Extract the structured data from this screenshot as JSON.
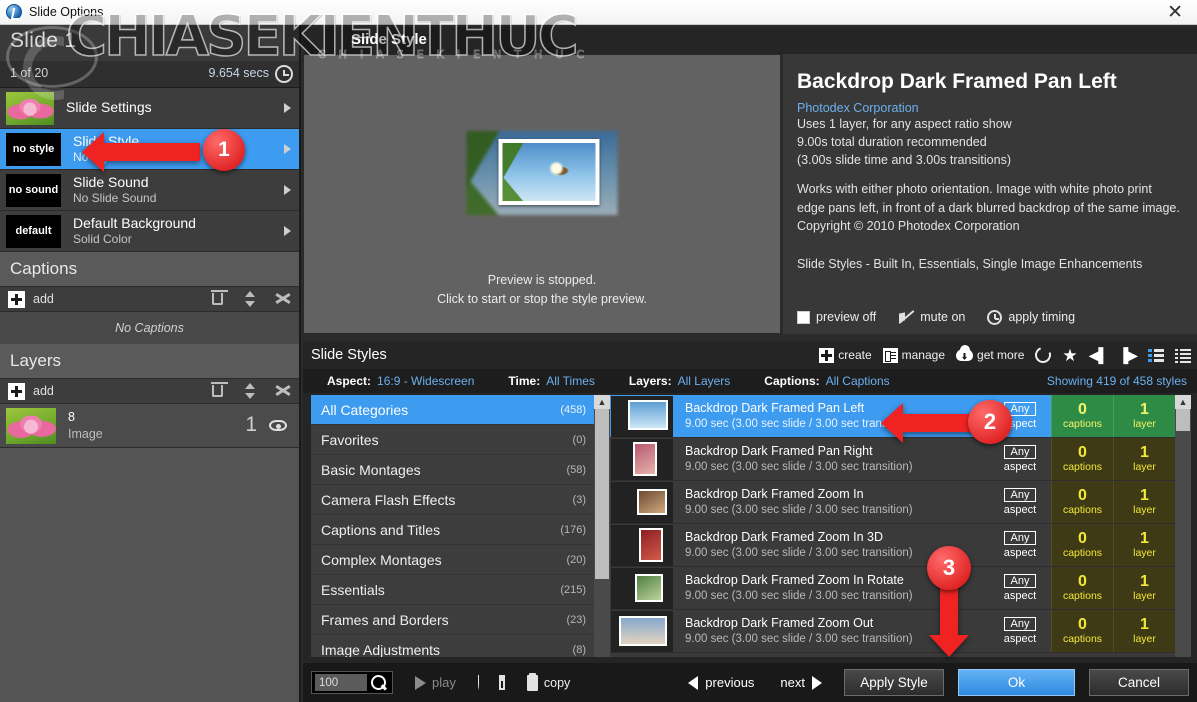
{
  "window": {
    "title": "Slide Options",
    "close_label": "✕",
    "app_icon": "photodex-icon",
    "close_icon": "close-icon"
  },
  "watermark": {
    "text": "CHIASEKIENTHUC",
    "sub_text": "CHIASEKIENTHUC"
  },
  "slide": {
    "title": "Slide 1",
    "count": "1 of 20",
    "duration": "9.654 secs",
    "clock_icon": "clock-icon",
    "options": [
      {
        "badge": "",
        "thumb": "lotus",
        "title": "Slide Settings",
        "subtitle": "",
        "selected": false
      },
      {
        "badge": "no style",
        "thumb": "",
        "title": "Slide Style",
        "subtitle": "No Style",
        "selected": true
      },
      {
        "badge": "no sound",
        "thumb": "",
        "title": "Slide Sound",
        "subtitle": "No Slide Sound",
        "selected": false
      },
      {
        "badge": "default",
        "thumb": "",
        "title": "Default Background",
        "subtitle": "Solid Color",
        "selected": false
      }
    ]
  },
  "captions": {
    "header": "Captions",
    "add_label": "add",
    "empty_text": "No Captions",
    "trash_icon": "trash-icon",
    "reorder_icon": "reorder-icon",
    "tools_icon": "tools-icon"
  },
  "layers": {
    "header": "Layers",
    "add_label": "add",
    "trash_icon": "trash-icon",
    "reorder_icon": "reorder-icon",
    "tools_icon": "tools-icon",
    "rows": [
      {
        "name": "8",
        "type": "Image",
        "index": "1",
        "eye_icon": "eye-icon"
      }
    ]
  },
  "preview": {
    "tab_label": "Slide Style",
    "line1": "Preview is stopped.",
    "line2": "Click to start or stop the style preview."
  },
  "info": {
    "title": "Backdrop Dark Framed Pan Left",
    "vendor": "Photodex Corporation",
    "meta1": "Uses 1 layer, for any aspect ratio show",
    "meta2": "9.00s total duration recommended",
    "meta3": "(3.00s slide time and 3.00s transitions)",
    "description": "Works with either photo orientation. Image with white photo print edge pans left, in front of a dark blurred backdrop of the same image. Copyright © 2010 Photodex Corporation",
    "path": "Slide Styles - Built In, Essentials, Single Image Enhancements",
    "options": [
      {
        "label": "preview off",
        "icon": "checkbox-icon"
      },
      {
        "label": "mute on",
        "icon": "mute-icon"
      },
      {
        "label": "apply timing",
        "icon": "clock-icon"
      }
    ]
  },
  "styles_panel": {
    "title": "Slide Styles",
    "tools": [
      {
        "label": "create",
        "icon": "plus-square-icon"
      },
      {
        "label": "manage",
        "icon": "manage-list-icon"
      },
      {
        "label": "get more",
        "icon": "cloud-download-icon"
      }
    ],
    "icon_tools": [
      {
        "icon": "refresh-icon"
      },
      {
        "icon": "star-icon"
      },
      {
        "icon": "skip-previous-icon"
      },
      {
        "icon": "skip-next-icon"
      },
      {
        "icon": "detail-view-icon"
      },
      {
        "icon": "list-view-icon"
      }
    ],
    "filters": [
      {
        "label": "Aspect:",
        "value": "16:9 - Widescreen"
      },
      {
        "label": "Time:",
        "value": "All Times"
      },
      {
        "label": "Layers:",
        "value": "All Layers"
      },
      {
        "label": "Captions:",
        "value": "All Captions"
      }
    ],
    "showing": "Showing 419 of 458 styles",
    "categories": [
      {
        "label": "All Categories",
        "count": "(458)",
        "selected": true
      },
      {
        "label": "Favorites",
        "count": "(0)",
        "selected": false
      },
      {
        "label": "Basic Montages",
        "count": "(58)",
        "selected": false
      },
      {
        "label": "Camera Flash Effects",
        "count": "(3)",
        "selected": false
      },
      {
        "label": "Captions and Titles",
        "count": "(176)",
        "selected": false
      },
      {
        "label": "Complex Montages",
        "count": "(20)",
        "selected": false
      },
      {
        "label": "Essentials",
        "count": "(215)",
        "selected": false
      },
      {
        "label": "Frames and Borders",
        "count": "(23)",
        "selected": false
      },
      {
        "label": "Image Adjustments",
        "count": "(8)",
        "selected": false
      }
    ],
    "styles": [
      {
        "name": "Backdrop Dark Framed Pan Left",
        "timing": "9.00 sec (3.00 sec slide / 3.00 sec transition)",
        "aspect": "Any",
        "aspect_sub": "aspect",
        "captions": "0",
        "captions_sub": "captions",
        "layers": "1",
        "layers_sub": "layer",
        "selected": true
      },
      {
        "name": "Backdrop Dark Framed Pan Right",
        "timing": "9.00 sec (3.00 sec slide / 3.00 sec transition)",
        "aspect": "Any",
        "aspect_sub": "aspect",
        "captions": "0",
        "captions_sub": "captions",
        "layers": "1",
        "layers_sub": "layer",
        "selected": false
      },
      {
        "name": "Backdrop Dark Framed Zoom In",
        "timing": "9.00 sec (3.00 sec slide / 3.00 sec transition)",
        "aspect": "Any",
        "aspect_sub": "aspect",
        "captions": "0",
        "captions_sub": "captions",
        "layers": "1",
        "layers_sub": "layer",
        "selected": false
      },
      {
        "name": "Backdrop Dark Framed Zoom In 3D",
        "timing": "9.00 sec (3.00 sec slide / 3.00 sec transition)",
        "aspect": "Any",
        "aspect_sub": "aspect",
        "captions": "0",
        "captions_sub": "captions",
        "layers": "1",
        "layers_sub": "layer",
        "selected": false
      },
      {
        "name": "Backdrop Dark Framed Zoom In Rotate",
        "timing": "9.00 sec (3.00 sec slide / 3.00 sec transition)",
        "aspect": "Any",
        "aspect_sub": "aspect",
        "captions": "0",
        "captions_sub": "captions",
        "layers": "1",
        "layers_sub": "layer",
        "selected": false
      },
      {
        "name": "Backdrop Dark Framed Zoom Out",
        "timing": "9.00 sec (3.00 sec slide / 3.00 sec transition)",
        "aspect": "Any",
        "aspect_sub": "aspect",
        "captions": "0",
        "captions_sub": "captions",
        "layers": "1",
        "layers_sub": "layer",
        "selected": false
      }
    ]
  },
  "bottom": {
    "zoom_value": "100",
    "search_icon": "magnifier-icon",
    "play_label": "play",
    "play_icon": "play-icon",
    "shield_icon": "shield-icon",
    "window_icon": "window-icon",
    "copy_label": "copy",
    "copy_icon": "clipboard-icon",
    "previous_label": "previous",
    "next_label": "next",
    "apply_label": "Apply Style",
    "ok_label": "Ok",
    "cancel_label": "Cancel"
  },
  "annotations": [
    {
      "number": "1"
    },
    {
      "number": "2"
    },
    {
      "number": "3"
    }
  ],
  "colors": {
    "accent": "#3d9bf0",
    "callout": "#e02323",
    "link": "#6cb0ee",
    "badge_yellow": "#f2e836",
    "badge_green": "#2e8b45"
  }
}
